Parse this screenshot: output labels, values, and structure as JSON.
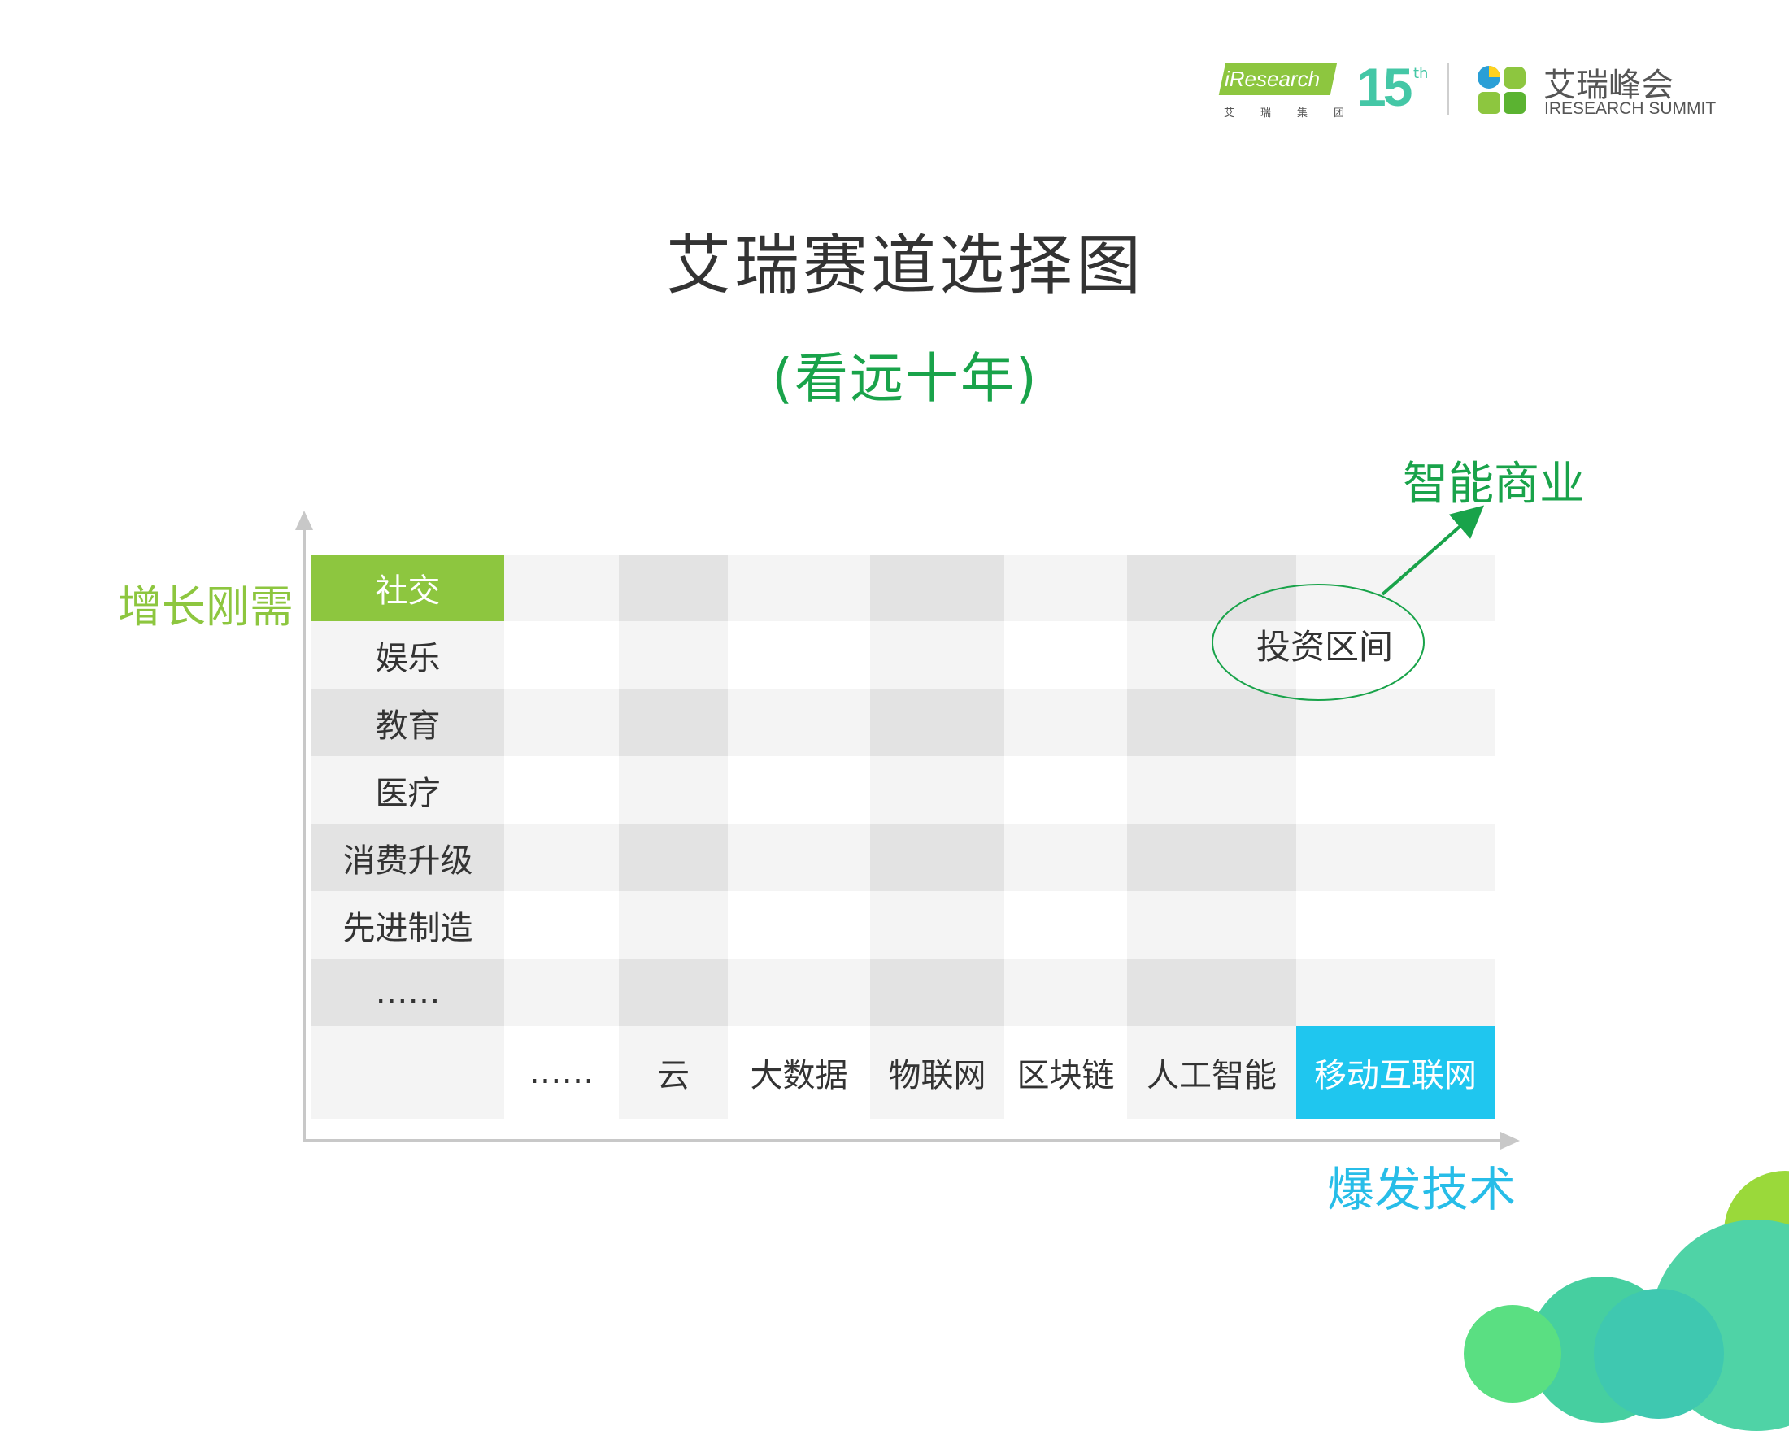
{
  "logo": {
    "group_brand": "iResearch",
    "group_sub": "艾瑞集团",
    "anniversary_number": "15",
    "anniversary_suffix": "th",
    "summit_cn": "艾瑞峰会",
    "summit_en": "IRESEARCH SUMMIT"
  },
  "title": "艾瑞赛道选择图",
  "subtitle": "(看远十年)",
  "axes": {
    "y_label": "增长刚需",
    "x_label": "爆发技术",
    "corner_label": "智能商业"
  },
  "oval_label": "投资区间",
  "rows": [
    "社交",
    "娱乐",
    "教育",
    "医疗",
    "消费升级",
    "先进制造",
    "……"
  ],
  "columns": [
    "……",
    "云",
    "大数据",
    "物联网",
    "区块链",
    "人工智能",
    "移动互联网"
  ],
  "colors": {
    "green_highlight": "#8dc63f",
    "blue_highlight": "#1fc6ef",
    "accent_green": "#19a34a",
    "grid_dark": "#e3e3e3",
    "grid_light": "#f4f4f4",
    "grid_white": "#ffffff"
  }
}
